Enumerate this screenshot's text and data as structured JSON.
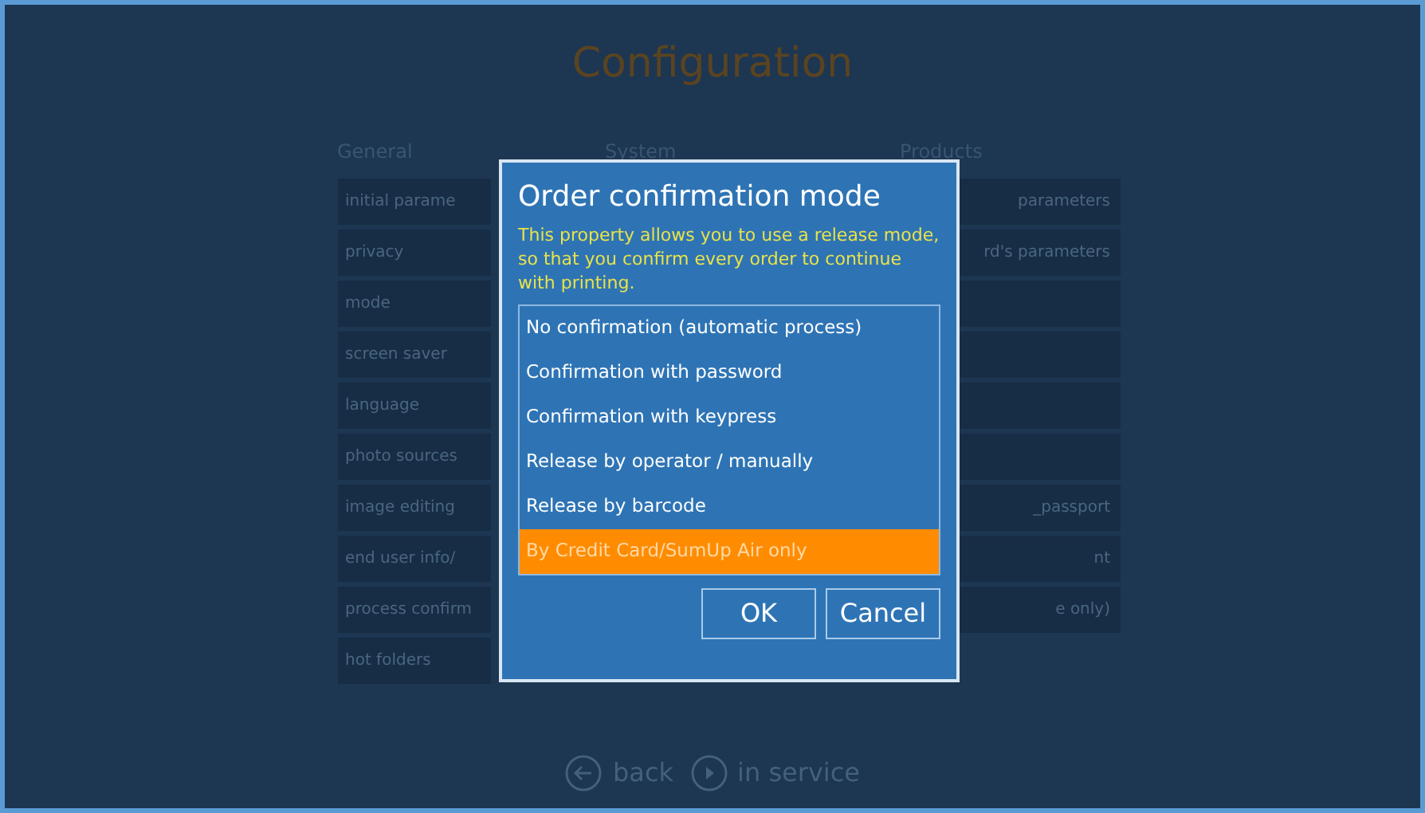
{
  "page": {
    "title": "Configuration"
  },
  "columns": [
    {
      "heading": "General",
      "items": [
        {
          "label": "initial parame"
        },
        {
          "label": "privacy"
        },
        {
          "label": "mode"
        },
        {
          "label": "screen saver"
        },
        {
          "label": "language"
        },
        {
          "label": "photo sources"
        },
        {
          "label": "image editing"
        },
        {
          "label": "end user info/"
        },
        {
          "label": "process confirm"
        },
        {
          "label": "hot folders"
        }
      ]
    },
    {
      "heading": "System"
    },
    {
      "heading": "Products",
      "items": [
        {
          "label": "parameters"
        },
        {
          "label": "rd's parameters"
        },
        {
          "kind": "blank"
        },
        {
          "kind": "blank"
        },
        {
          "kind": "blank"
        },
        {
          "kind": "blank"
        },
        {
          "label": "_passport"
        },
        {
          "label": "nt"
        },
        {
          "label": "e only)"
        }
      ]
    }
  ],
  "dialog": {
    "title": "Order confirmation mode",
    "description": "This property allows you to use a release mode, so that you confirm every order to continue with printing.",
    "options": [
      {
        "label": "No confirmation (automatic process)",
        "selected": false
      },
      {
        "label": "Confirmation with password",
        "selected": false
      },
      {
        "label": "Confirmation with keypress",
        "selected": false
      },
      {
        "label": "Release by operator / manually",
        "selected": false
      },
      {
        "label": "Release by barcode",
        "selected": false
      },
      {
        "label": "By Credit Card/SumUp Air only",
        "selected": true
      }
    ],
    "buttons": [
      "OK",
      "Cancel"
    ]
  },
  "footer": {
    "back": "back",
    "next": "in service"
  }
}
